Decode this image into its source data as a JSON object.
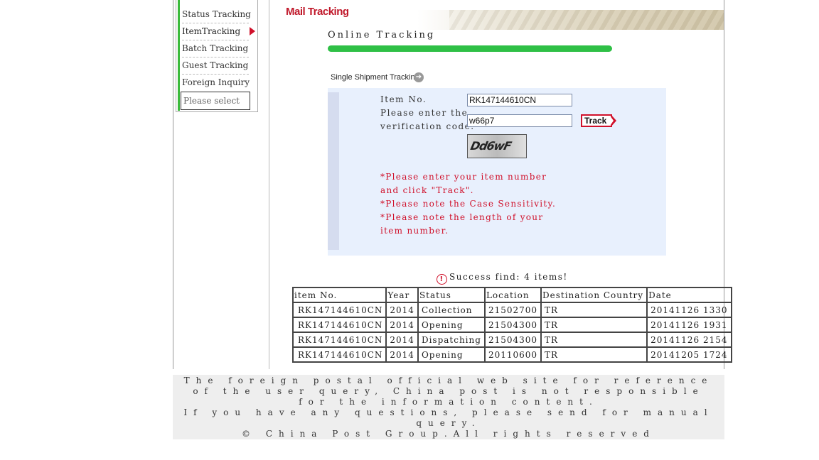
{
  "sidebar": {
    "items": [
      {
        "label": "Status Tracking"
      },
      {
        "label": "ItemTracking"
      },
      {
        "label": "Batch Tracking"
      },
      {
        "label": "Guest Tracking"
      },
      {
        "label": "Foreign Inquiry"
      }
    ],
    "select_label": "Please select"
  },
  "header": {
    "banner_title": "Mail Tracking",
    "page_title": "Online Tracking"
  },
  "form": {
    "section_label": "Single Shipment Tracking",
    "item_no_label": "Item No.",
    "item_no_value": "RK147144610CN",
    "verification_label_1": "Please enter the",
    "verification_label_2": "verification code.",
    "verification_value": "w66p7",
    "track_button": "Track",
    "captcha_text": "Dd6wF",
    "notes": [
      "*Please enter your item number and click \"Track\".",
      "*Please note the Case Sensitivity.",
      "*Please note the length of your item number."
    ]
  },
  "results": {
    "summary": "Success find: 4 items!",
    "columns": [
      "item No.",
      "Year",
      "Status",
      "Location",
      "Destination Country",
      "Date"
    ],
    "rows": [
      [
        "RK147144610CN",
        "2014",
        "Collection",
        "21502700",
        "TR",
        "20141126 1330"
      ],
      [
        "RK147144610CN",
        "2014",
        "Opening",
        "21504300",
        "TR",
        "20141126 1931"
      ],
      [
        "RK147144610CN",
        "2014",
        "Dispatching",
        "21504300",
        "TR",
        "20141126 2154"
      ],
      [
        "RK147144610CN",
        "2014",
        "Opening",
        "20110600",
        "TR",
        "20141205 1724"
      ]
    ]
  },
  "footer": {
    "line1": "The foreign postal official web site for reference of the user query, China post is not responsible for the information content.",
    "line2": "If you have any questions, please send for manual query.",
    "line3": "© China Post Group.All rights reserved"
  },
  "colors": {
    "accent_red": "#d0102a",
    "progress_green": "#2fc046",
    "panel_blue": "#e8f0fd"
  }
}
